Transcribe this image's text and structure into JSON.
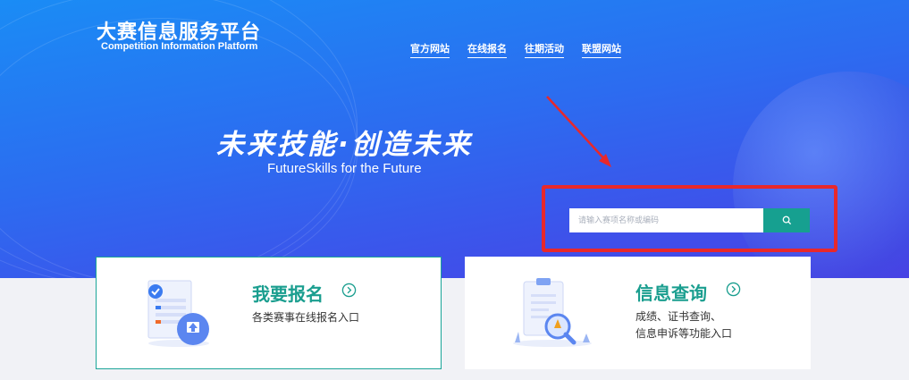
{
  "header": {
    "title": "大赛信息服务平台",
    "subtitle": "Competition Information Platform",
    "nav": [
      {
        "label": "官方网站"
      },
      {
        "label": "在线报名"
      },
      {
        "label": "往期活动"
      },
      {
        "label": "联盟网站"
      }
    ]
  },
  "hero": {
    "slogan_cn": "未来技能·创造未来",
    "slogan_en": "FutureSkills  for the Future"
  },
  "search": {
    "placeholder": "请输入赛项名称或编码",
    "button_icon": "search-icon",
    "highlight_color": "#e8282b"
  },
  "cards": [
    {
      "title": "我要报名",
      "desc_lines": [
        "各类赛事在线报名入口"
      ]
    },
    {
      "title": "信息查询",
      "desc_lines": [
        "成绩、证书查询、",
        "信息申诉等功能入口"
      ]
    }
  ],
  "colors": {
    "accent": "#1a9e8f",
    "hero_top": "#1a8cf5",
    "hero_bottom": "#4a3fe6"
  }
}
